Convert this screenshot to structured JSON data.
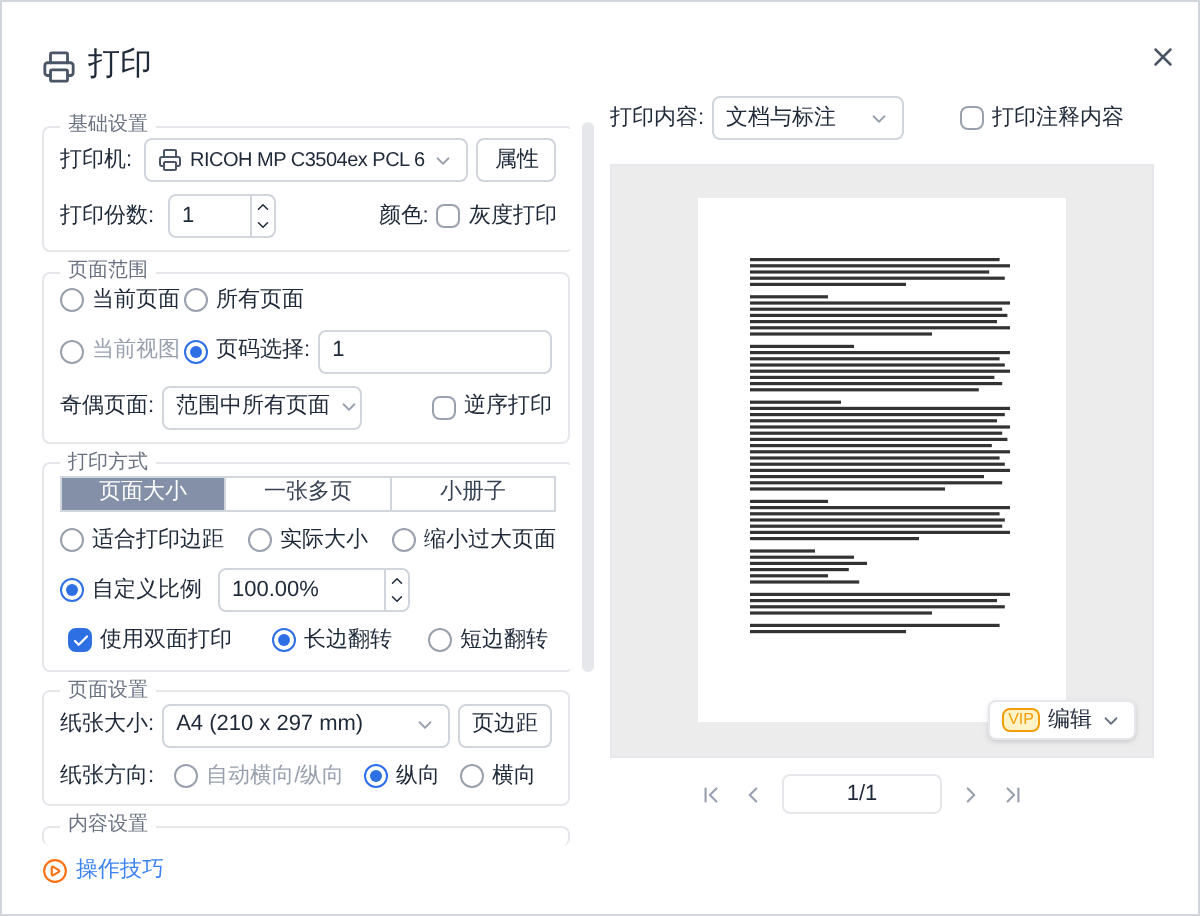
{
  "window": {
    "title": "打印"
  },
  "basic": {
    "legend": "基础设置",
    "printer_label": "打印机:",
    "printer": "RICOH MP C3504ex PCL 6",
    "properties_button": "属性",
    "copies_label": "打印份数:",
    "copies": "1",
    "color_label": "颜色:",
    "grayscale": {
      "label": "灰度打印",
      "checked": false
    }
  },
  "range": {
    "legend": "页面范围",
    "options": [
      {
        "label": "当前页面",
        "selected": false,
        "disabled": false
      },
      {
        "label": "所有页面",
        "selected": false,
        "disabled": false
      },
      {
        "label": "当前视图",
        "selected": false,
        "disabled": true
      },
      {
        "label": "页码选择:",
        "selected": true,
        "disabled": false
      }
    ],
    "page_selection": "1",
    "odd_even_label": "奇偶页面:",
    "odd_even": "范围中所有页面",
    "reverse": {
      "label": "逆序打印",
      "checked": false
    }
  },
  "mode": {
    "legend": "打印方式",
    "tabs": [
      {
        "label": "页面大小",
        "selected": true
      },
      {
        "label": "一张多页",
        "selected": false
      },
      {
        "label": "小册子",
        "selected": false
      }
    ],
    "scale_options": [
      {
        "label": "适合打印边距",
        "selected": false
      },
      {
        "label": "实际大小",
        "selected": false
      },
      {
        "label": "缩小过大页面",
        "selected": false
      },
      {
        "label": "自定义比例",
        "selected": true
      }
    ],
    "scale": "100.00%",
    "duplex": {
      "label": "使用双面打印",
      "checked": true
    },
    "flip_options": [
      {
        "label": "长边翻转",
        "selected": true
      },
      {
        "label": "短边翻转",
        "selected": false
      }
    ]
  },
  "page_setup": {
    "legend": "页面设置",
    "paper_label": "纸张大小:",
    "paper": "A4 (210 x 297 mm)",
    "margins_button": "页边距",
    "orientation_label": "纸张方向:",
    "orientation_options": [
      {
        "label": "自动横向/纵向",
        "selected": false,
        "disabled": true
      },
      {
        "label": "纵向",
        "selected": true,
        "disabled": false
      },
      {
        "label": "横向",
        "selected": false,
        "disabled": false
      }
    ]
  },
  "content_setup": {
    "legend": "内容设置"
  },
  "tips_link": "操作技巧",
  "print_content": {
    "label": "打印内容:",
    "value": "文档与标注",
    "annotations": {
      "label": "打印注释内容",
      "checked": false
    }
  },
  "preview": {
    "vip_badge": "VIP",
    "edit_button": "编辑",
    "page_indicator": "1/1"
  }
}
